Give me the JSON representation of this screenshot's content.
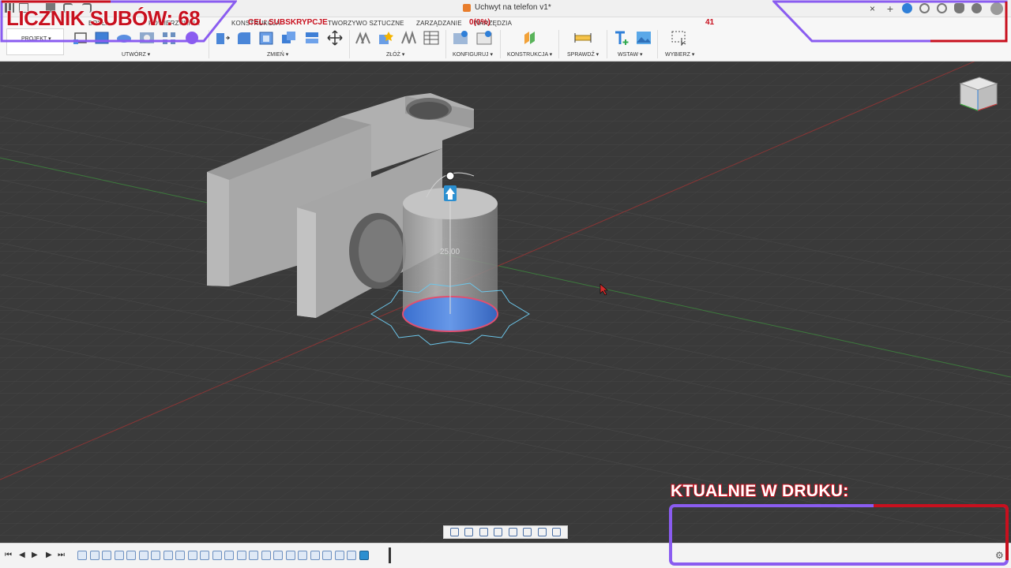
{
  "window": {
    "document_title": "Uchwyt na telefon v1*",
    "tab_close": "×",
    "tab_plus": "+"
  },
  "ribbon": {
    "tabs": [
      {
        "label": "BRYŁA"
      },
      {
        "label": "POWIERZCHNIA"
      },
      {
        "label": "KONSTRUKCJA"
      },
      {
        "label": "TWORZYWO SZTUCZNE"
      },
      {
        "label": "ZARZĄDZANIE"
      },
      {
        "label": "NARZĘDZIA"
      }
    ],
    "project_label": "PROJEKT ▾",
    "groups": [
      {
        "label": "UTWÓRZ ▾"
      },
      {
        "label": "ZMIEŃ ▾"
      },
      {
        "label": "ZŁÓŻ ▾"
      },
      {
        "label": "KONFIGURUJ ▾"
      },
      {
        "label": "KONSTRUKCJA ▾"
      },
      {
        "label": "SPRAWDŹ ▾"
      },
      {
        "label": "WSTAW ▾"
      },
      {
        "label": "WYBIERZ ▾"
      }
    ]
  },
  "viewport": {
    "dimension_label": "25.00"
  },
  "timeline": {
    "first": "⏮",
    "prev": "◀",
    "play": "▶",
    "next": "▶",
    "last": "⏭",
    "gear": "⚙"
  },
  "overlay": {
    "subscriber_counter": "LICZNIK SUBÓW: 68",
    "goal_label": "CEL: SUBSKRYPCJE",
    "goal_percent": "0(0%)",
    "goal_number": "41",
    "now_printing": "KTUALNIE W DRUKU:"
  },
  "colors": {
    "accent_red": "#c8101e",
    "accent_purple": "#8a5cf0",
    "face_blue": "#4b7fd6",
    "grid": "#4a4a4a"
  }
}
